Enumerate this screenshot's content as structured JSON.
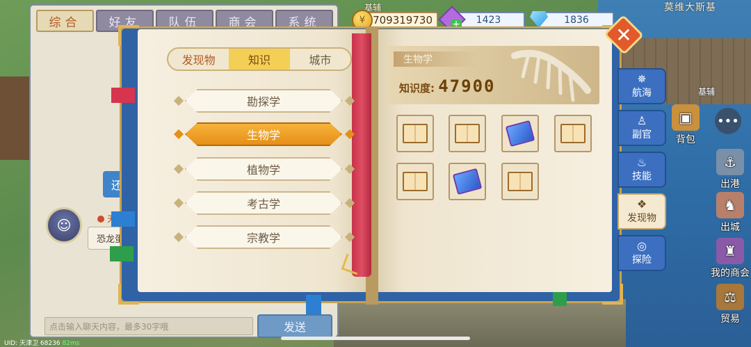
{
  "chat": {
    "tabs": [
      "综合",
      "好友",
      "队伍",
      "商会",
      "系统"
    ],
    "side_button": "还",
    "player_name": "天合",
    "message": "恐龙蛋",
    "input_placeholder": "点击输入聊天内容，最多30字哦",
    "send_label": "发送"
  },
  "top_bar": {
    "location_label": "基辅",
    "gold": "709319730",
    "gem_purple": "1423",
    "gem_blue": "1836",
    "region_title": "莫维大斯基",
    "dock_label": "基辅"
  },
  "book": {
    "category_tabs": [
      "发现物",
      "知识",
      "城市"
    ],
    "active_category": 1,
    "subjects": [
      "勘探学",
      "生物学",
      "植物学",
      "考古学",
      "宗教学"
    ],
    "active_subject": 1,
    "selected_subject_title": "生物学",
    "knowledge_label": "知识度:",
    "knowledge_value": "47900",
    "items": [
      {
        "kind": "book-icon"
      },
      {
        "kind": "book-icon"
      },
      {
        "kind": "blue-tome-icon"
      },
      {
        "kind": "book-icon"
      },
      {
        "kind": "book-icon"
      },
      {
        "kind": "blue-tome-icon"
      },
      {
        "kind": "book-icon"
      }
    ]
  },
  "side_tabs": [
    {
      "label": "航海",
      "icon": "compass-wheel-icon"
    },
    {
      "label": "副官",
      "icon": "officer-icon"
    },
    {
      "label": "技能",
      "icon": "flame-icon"
    },
    {
      "label": "发现物",
      "icon": "discovery-icon",
      "active": true
    },
    {
      "label": "探险",
      "icon": "compass-icon"
    }
  ],
  "hud": {
    "bag": "背包",
    "port": "出港",
    "city": "出城",
    "guild": "我的商会",
    "trade": "贸易"
  },
  "status": {
    "uid": "UID: 天津卫 68236",
    "net": "82ms"
  },
  "colors": {
    "book_cover": "#2f63a6",
    "active_tab": "#f4cf56",
    "active_subject": "#e58f18",
    "ribbon": "#c5324a"
  }
}
